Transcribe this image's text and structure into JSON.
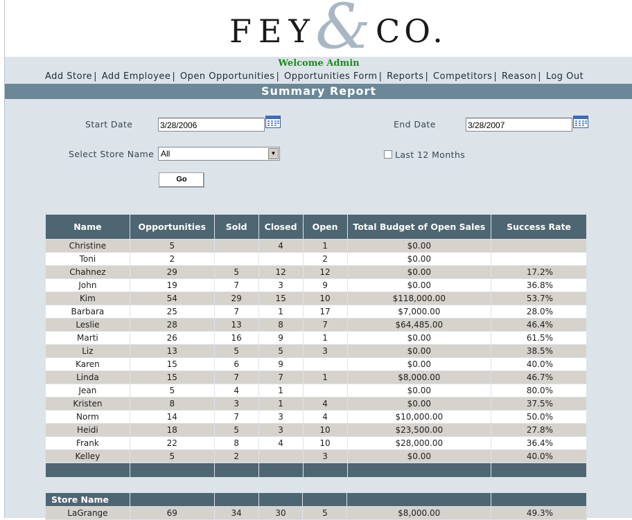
{
  "logo": {
    "left": "FEY",
    "amp": "&",
    "right": "CO."
  },
  "welcome": "Welcome  Admin",
  "nav": [
    "Add Store",
    "Add Employee",
    "Open Opportunities",
    "Opportunities Form",
    "Reports",
    "Competitors",
    "Reason",
    "Log Out"
  ],
  "page_title": "Summary Report",
  "filters": {
    "start_label": "Start Date",
    "start_value": "3/28/2006",
    "end_label": "End Date",
    "end_value": "3/28/2007",
    "store_label": "Select Store Name",
    "store_value": "All",
    "last12_label": "Last 12 Months",
    "go_label": "Go"
  },
  "table": {
    "headers": [
      "Name",
      "Opportunities",
      "Sold",
      "Closed",
      "Open",
      "Total Budget of Open Sales",
      "Success Rate"
    ],
    "rows": [
      [
        "Christine",
        "5",
        "",
        "4",
        "1",
        "$0.00",
        ""
      ],
      [
        "Toni",
        "2",
        "",
        "",
        "2",
        "$0.00",
        ""
      ],
      [
        "Chahnez",
        "29",
        "5",
        "12",
        "12",
        "$0.00",
        "17.2%"
      ],
      [
        "John",
        "19",
        "7",
        "3",
        "9",
        "$0.00",
        "36.8%"
      ],
      [
        "Kim",
        "54",
        "29",
        "15",
        "10",
        "$118,000.00",
        "53.7%"
      ],
      [
        "Barbara",
        "25",
        "7",
        "1",
        "17",
        "$7,000.00",
        "28.0%"
      ],
      [
        "Leslie",
        "28",
        "13",
        "8",
        "7",
        "$64,485.00",
        "46.4%"
      ],
      [
        "Marti",
        "26",
        "16",
        "9",
        "1",
        "$0.00",
        "61.5%"
      ],
      [
        "Liz",
        "13",
        "5",
        "5",
        "3",
        "$0.00",
        "38.5%"
      ],
      [
        "Karen",
        "15",
        "6",
        "9",
        "",
        "$0.00",
        "40.0%"
      ],
      [
        "Linda",
        "15",
        "7",
        "7",
        "1",
        "$8,000.00",
        "46.7%"
      ],
      [
        "Jean",
        "5",
        "4",
        "1",
        "",
        "$0.00",
        "80.0%"
      ],
      [
        "Kristen",
        "8",
        "3",
        "1",
        "4",
        "$0.00",
        "37.5%"
      ],
      [
        "Norm",
        "14",
        "7",
        "3",
        "4",
        "$10,000.00",
        "50.0%"
      ],
      [
        "Heidi",
        "18",
        "5",
        "3",
        "10",
        "$23,500.00",
        "27.8%"
      ],
      [
        "Frank",
        "22",
        "8",
        "4",
        "10",
        "$28,000.00",
        "36.4%"
      ],
      [
        "Kelley",
        "5",
        "2",
        "",
        "3",
        "$0.00",
        "40.0%"
      ]
    ]
  },
  "store_table": {
    "header": "Store Name",
    "rows": [
      [
        "LaGrange",
        "69",
        "34",
        "30",
        "5",
        "$8,000.00",
        "49.3%"
      ]
    ]
  }
}
